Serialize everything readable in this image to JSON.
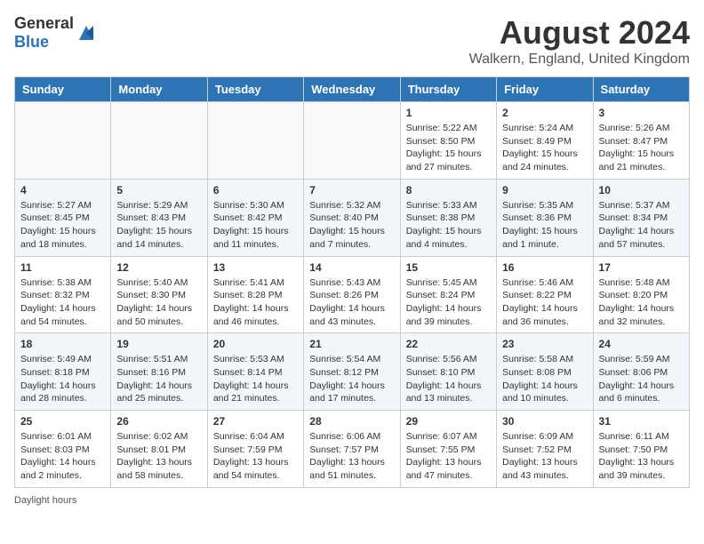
{
  "header": {
    "logo_general": "General",
    "logo_blue": "Blue",
    "month_year": "August 2024",
    "location": "Walkern, England, United Kingdom"
  },
  "days_of_week": [
    "Sunday",
    "Monday",
    "Tuesday",
    "Wednesday",
    "Thursday",
    "Friday",
    "Saturday"
  ],
  "weeks": [
    [
      {
        "day": "",
        "info": ""
      },
      {
        "day": "",
        "info": ""
      },
      {
        "day": "",
        "info": ""
      },
      {
        "day": "",
        "info": ""
      },
      {
        "day": "1",
        "info": "Sunrise: 5:22 AM\nSunset: 8:50 PM\nDaylight: 15 hours and 27 minutes."
      },
      {
        "day": "2",
        "info": "Sunrise: 5:24 AM\nSunset: 8:49 PM\nDaylight: 15 hours and 24 minutes."
      },
      {
        "day": "3",
        "info": "Sunrise: 5:26 AM\nSunset: 8:47 PM\nDaylight: 15 hours and 21 minutes."
      }
    ],
    [
      {
        "day": "4",
        "info": "Sunrise: 5:27 AM\nSunset: 8:45 PM\nDaylight: 15 hours and 18 minutes."
      },
      {
        "day": "5",
        "info": "Sunrise: 5:29 AM\nSunset: 8:43 PM\nDaylight: 15 hours and 14 minutes."
      },
      {
        "day": "6",
        "info": "Sunrise: 5:30 AM\nSunset: 8:42 PM\nDaylight: 15 hours and 11 minutes."
      },
      {
        "day": "7",
        "info": "Sunrise: 5:32 AM\nSunset: 8:40 PM\nDaylight: 15 hours and 7 minutes."
      },
      {
        "day": "8",
        "info": "Sunrise: 5:33 AM\nSunset: 8:38 PM\nDaylight: 15 hours and 4 minutes."
      },
      {
        "day": "9",
        "info": "Sunrise: 5:35 AM\nSunset: 8:36 PM\nDaylight: 15 hours and 1 minute."
      },
      {
        "day": "10",
        "info": "Sunrise: 5:37 AM\nSunset: 8:34 PM\nDaylight: 14 hours and 57 minutes."
      }
    ],
    [
      {
        "day": "11",
        "info": "Sunrise: 5:38 AM\nSunset: 8:32 PM\nDaylight: 14 hours and 54 minutes."
      },
      {
        "day": "12",
        "info": "Sunrise: 5:40 AM\nSunset: 8:30 PM\nDaylight: 14 hours and 50 minutes."
      },
      {
        "day": "13",
        "info": "Sunrise: 5:41 AM\nSunset: 8:28 PM\nDaylight: 14 hours and 46 minutes."
      },
      {
        "day": "14",
        "info": "Sunrise: 5:43 AM\nSunset: 8:26 PM\nDaylight: 14 hours and 43 minutes."
      },
      {
        "day": "15",
        "info": "Sunrise: 5:45 AM\nSunset: 8:24 PM\nDaylight: 14 hours and 39 minutes."
      },
      {
        "day": "16",
        "info": "Sunrise: 5:46 AM\nSunset: 8:22 PM\nDaylight: 14 hours and 36 minutes."
      },
      {
        "day": "17",
        "info": "Sunrise: 5:48 AM\nSunset: 8:20 PM\nDaylight: 14 hours and 32 minutes."
      }
    ],
    [
      {
        "day": "18",
        "info": "Sunrise: 5:49 AM\nSunset: 8:18 PM\nDaylight: 14 hours and 28 minutes."
      },
      {
        "day": "19",
        "info": "Sunrise: 5:51 AM\nSunset: 8:16 PM\nDaylight: 14 hours and 25 minutes."
      },
      {
        "day": "20",
        "info": "Sunrise: 5:53 AM\nSunset: 8:14 PM\nDaylight: 14 hours and 21 minutes."
      },
      {
        "day": "21",
        "info": "Sunrise: 5:54 AM\nSunset: 8:12 PM\nDaylight: 14 hours and 17 minutes."
      },
      {
        "day": "22",
        "info": "Sunrise: 5:56 AM\nSunset: 8:10 PM\nDaylight: 14 hours and 13 minutes."
      },
      {
        "day": "23",
        "info": "Sunrise: 5:58 AM\nSunset: 8:08 PM\nDaylight: 14 hours and 10 minutes."
      },
      {
        "day": "24",
        "info": "Sunrise: 5:59 AM\nSunset: 8:06 PM\nDaylight: 14 hours and 6 minutes."
      }
    ],
    [
      {
        "day": "25",
        "info": "Sunrise: 6:01 AM\nSunset: 8:03 PM\nDaylight: 14 hours and 2 minutes."
      },
      {
        "day": "26",
        "info": "Sunrise: 6:02 AM\nSunset: 8:01 PM\nDaylight: 13 hours and 58 minutes."
      },
      {
        "day": "27",
        "info": "Sunrise: 6:04 AM\nSunset: 7:59 PM\nDaylight: 13 hours and 54 minutes."
      },
      {
        "day": "28",
        "info": "Sunrise: 6:06 AM\nSunset: 7:57 PM\nDaylight: 13 hours and 51 minutes."
      },
      {
        "day": "29",
        "info": "Sunrise: 6:07 AM\nSunset: 7:55 PM\nDaylight: 13 hours and 47 minutes."
      },
      {
        "day": "30",
        "info": "Sunrise: 6:09 AM\nSunset: 7:52 PM\nDaylight: 13 hours and 43 minutes."
      },
      {
        "day": "31",
        "info": "Sunrise: 6:11 AM\nSunset: 7:50 PM\nDaylight: 13 hours and 39 minutes."
      }
    ]
  ],
  "footer": {
    "text": "Daylight hours"
  }
}
